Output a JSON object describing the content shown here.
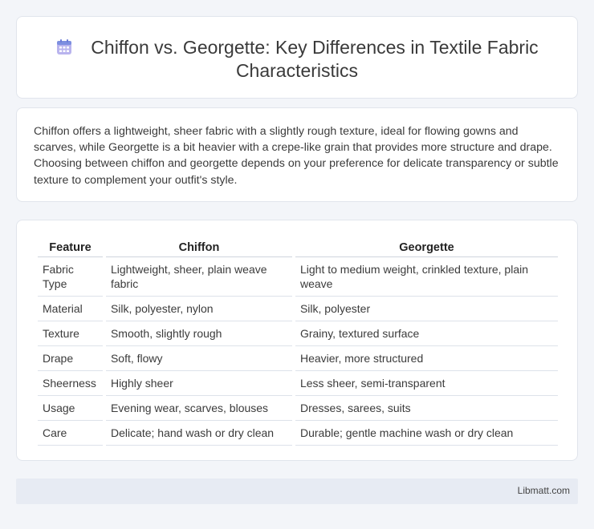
{
  "header": {
    "icon": "calendar-icon",
    "title": "Chiffon vs. Georgette: Key Differences in Textile Fabric Characteristics"
  },
  "description": "Chiffon offers a lightweight, sheer fabric with a slightly rough texture, ideal for flowing gowns and scarves, while Georgette is a bit heavier with a crepe-like grain that provides more structure and drape. Choosing between chiffon and georgette depends on your preference for delicate transparency or subtle texture to complement your outfit's style.",
  "table": {
    "headers": [
      "Feature",
      "Chiffon",
      "Georgette"
    ],
    "rows": [
      [
        "Fabric Type",
        "Lightweight, sheer, plain weave fabric",
        "Light to medium weight, crinkled texture, plain weave"
      ],
      [
        "Material",
        "Silk, polyester, nylon",
        "Silk, polyester"
      ],
      [
        "Texture",
        "Smooth, slightly rough",
        "Grainy, textured surface"
      ],
      [
        "Drape",
        "Soft, flowy",
        "Heavier, more structured"
      ],
      [
        "Sheerness",
        "Highly sheer",
        "Less sheer, semi-transparent"
      ],
      [
        "Usage",
        "Evening wear, scarves, blouses",
        "Dresses, sarees, suits"
      ],
      [
        "Care",
        "Delicate; hand wash or dry clean",
        "Durable; gentle machine wash or dry clean"
      ]
    ]
  },
  "footer": {
    "site": "Libmatt.com"
  },
  "colors": {
    "background": "#f3f5f9",
    "card": "#ffffff",
    "footer": "#e7ebf3",
    "icon_accent": "#8a7fd4"
  }
}
